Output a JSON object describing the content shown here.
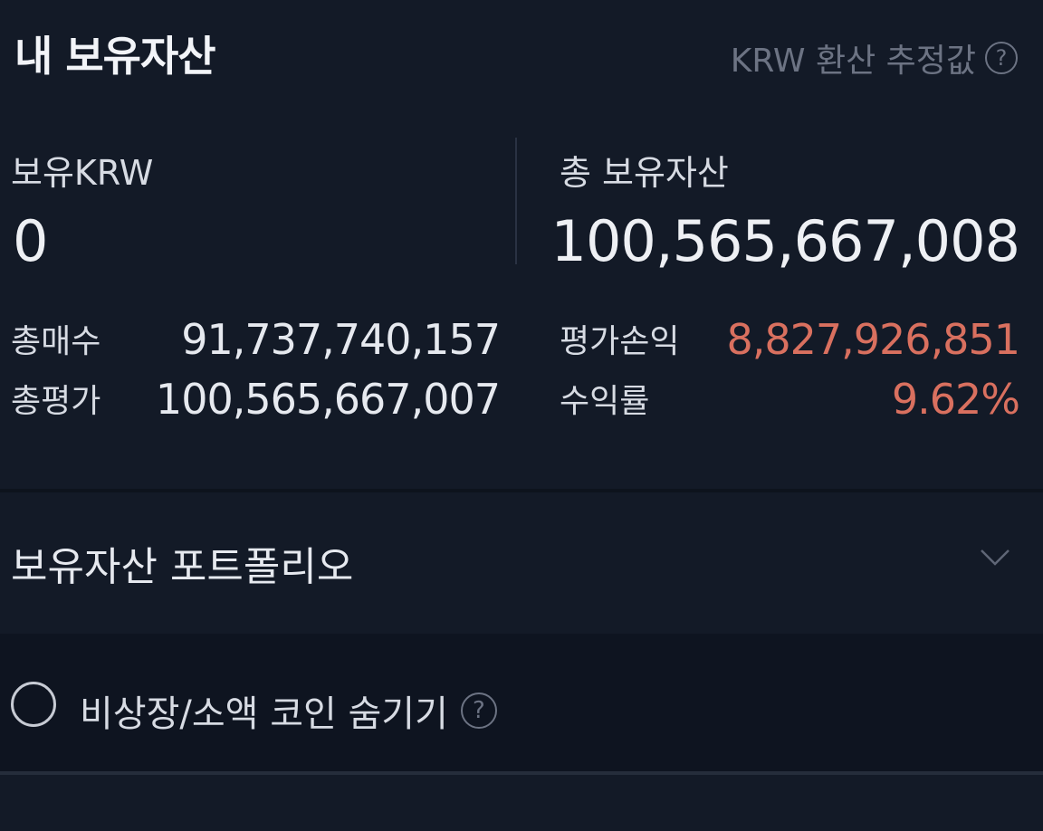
{
  "header": {
    "title": "내 보유자산",
    "krw_note": "KRW 환산 추정값",
    "help_symbol": "?"
  },
  "summary": {
    "krw_label": "보유KRW",
    "krw_value": "0",
    "total_label": "총 보유자산",
    "total_value": "100,565,667,008",
    "total_buy_label": "총매수",
    "total_buy_value": "91,737,740,157",
    "total_eval_label": "총평가",
    "total_eval_value": "100,565,667,007",
    "pnl_label": "평가손익",
    "pnl_value": "8,827,926,851",
    "return_label": "수익률",
    "return_value": "9.62%"
  },
  "portfolio": {
    "title": "보유자산 포트폴리오"
  },
  "filter": {
    "hide_label": "비상장/소액 코인 숨기기",
    "help_symbol": "?"
  },
  "colors": {
    "background": "#131a27",
    "profit": "#d9705f",
    "muted": "#6c7383"
  }
}
